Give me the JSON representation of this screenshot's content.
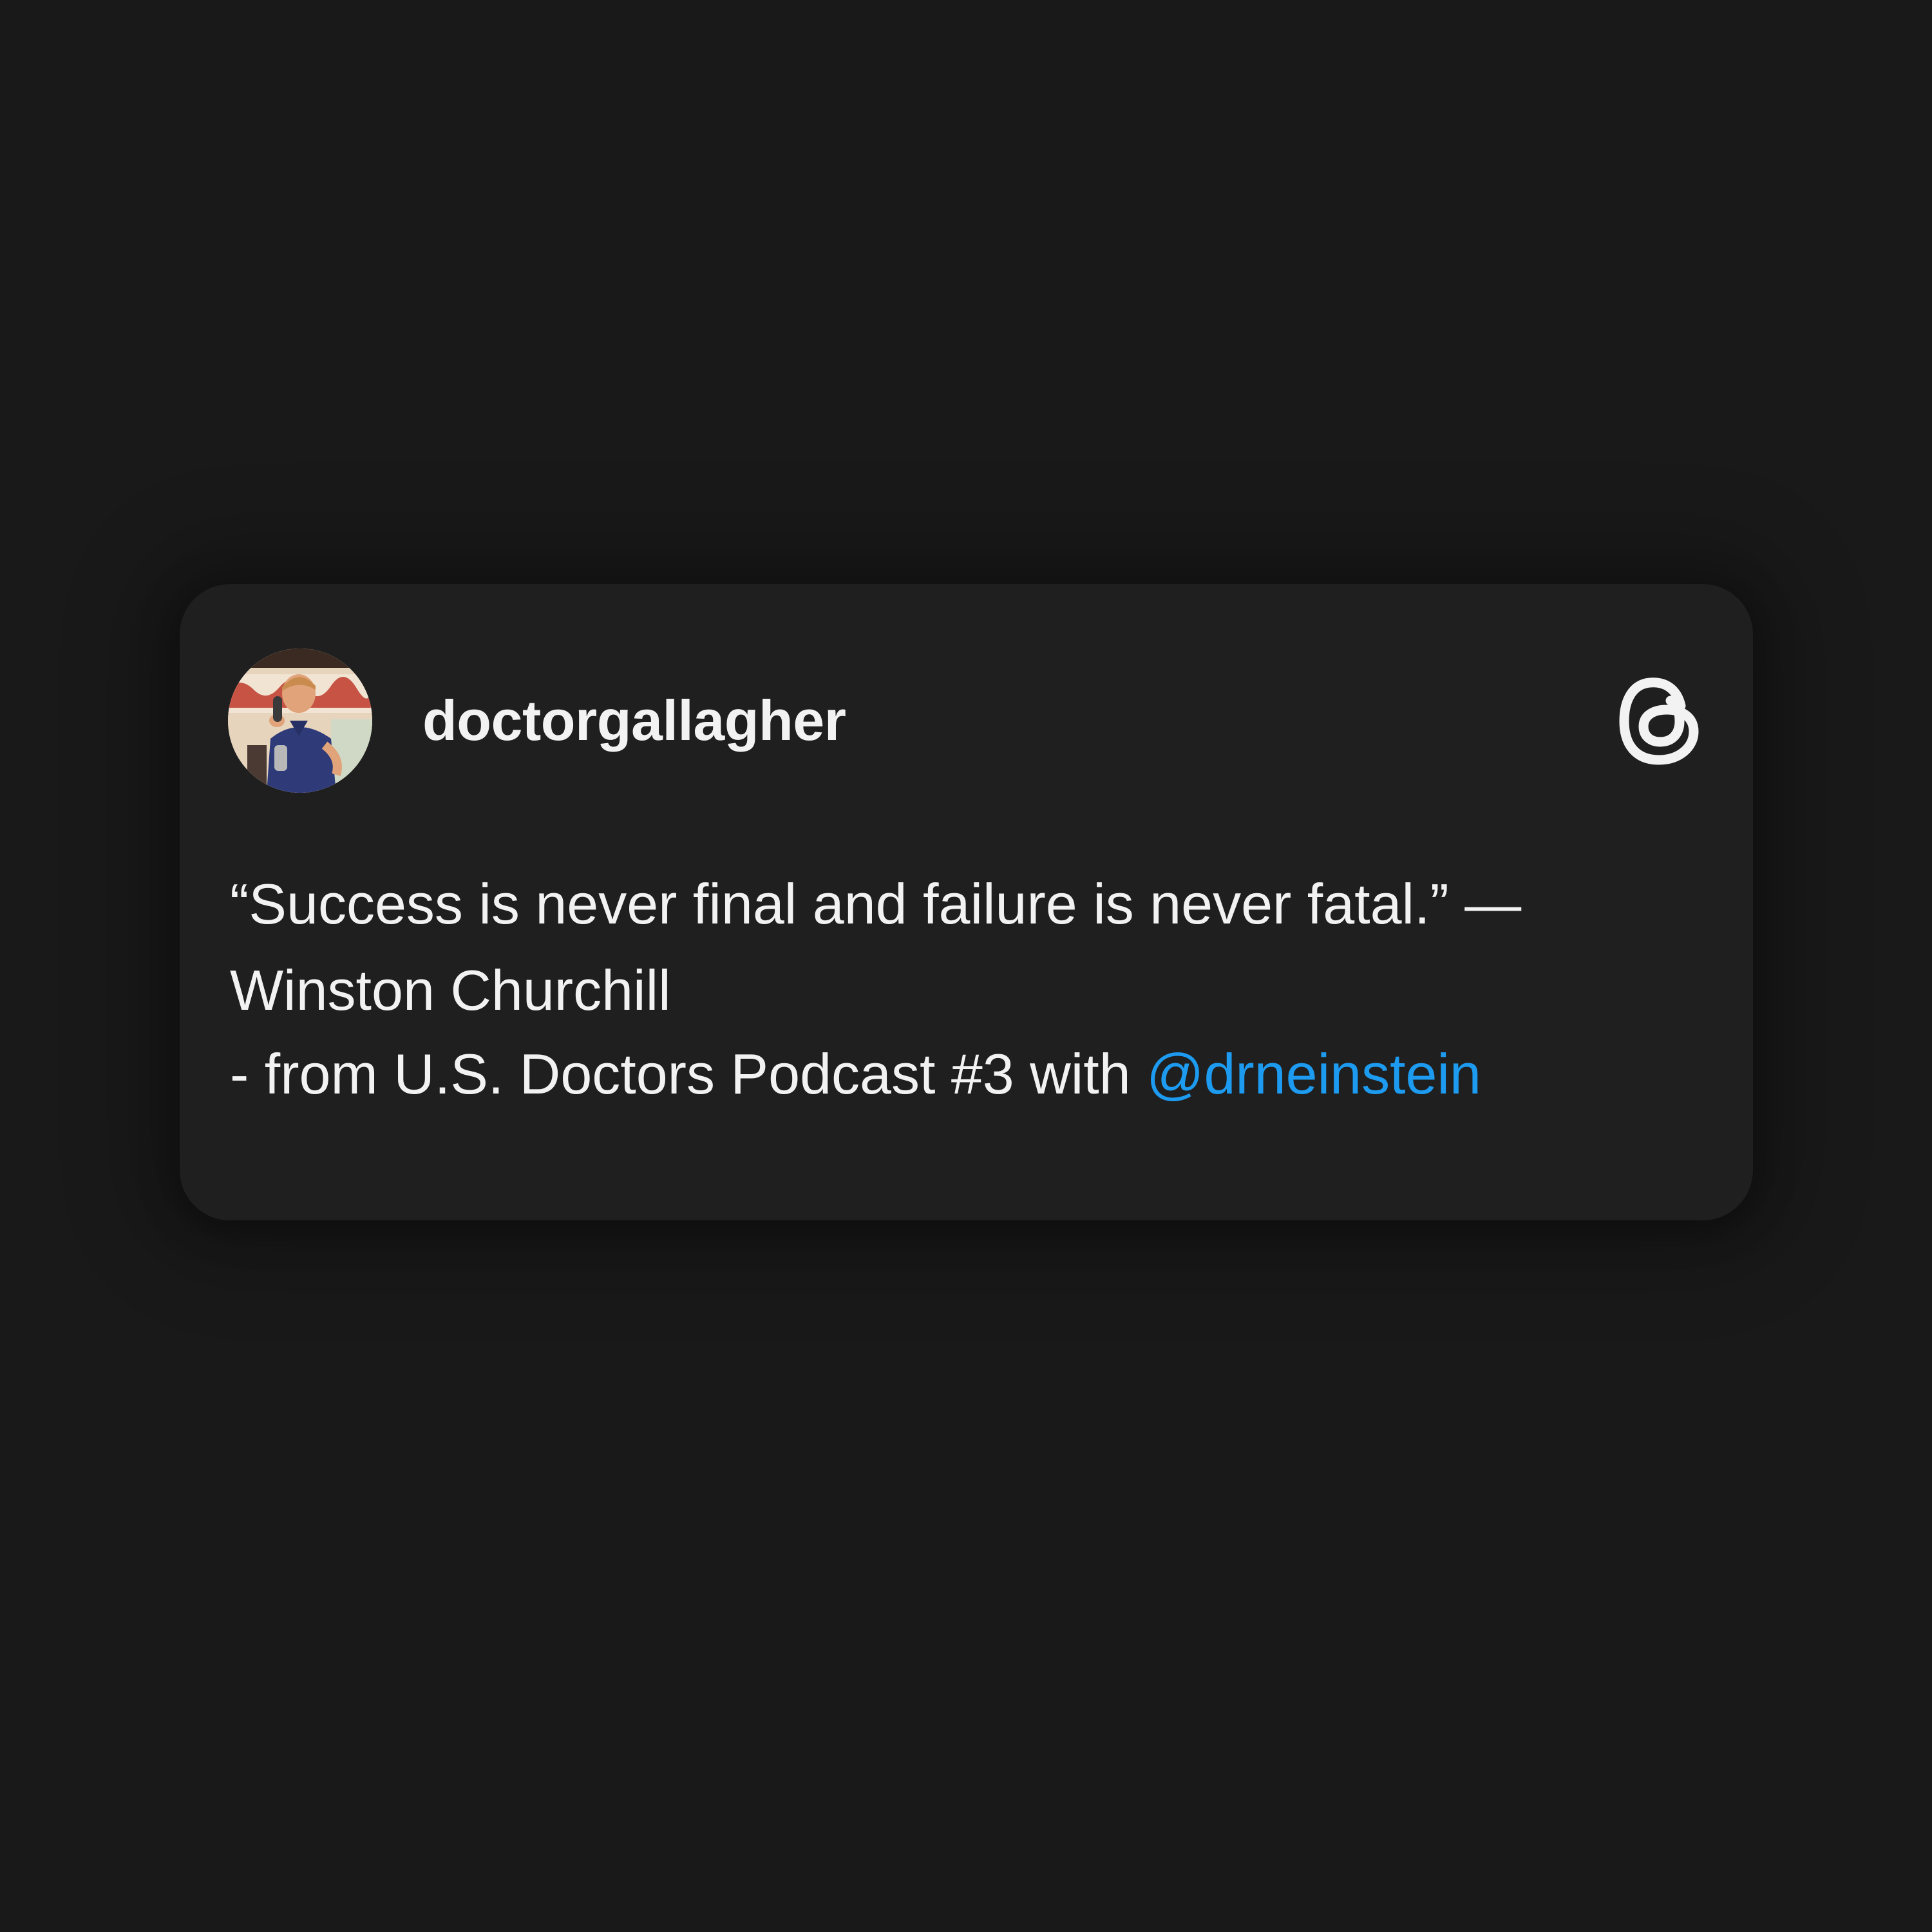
{
  "post": {
    "username": "doctorgallagher",
    "quote": "“Success is never final and failure is never fatal.” — Winston Churchill",
    "source_prefix": "- from U.S. Doctors Podcast #3 with",
    "mention": "@drneinstein"
  },
  "icons": {
    "brand": "threads-logo-icon"
  },
  "colors": {
    "page_background": "#191919",
    "card_background": "#1f1f1f",
    "text": "#f2f2f2",
    "mention": "#1d9bf0"
  }
}
